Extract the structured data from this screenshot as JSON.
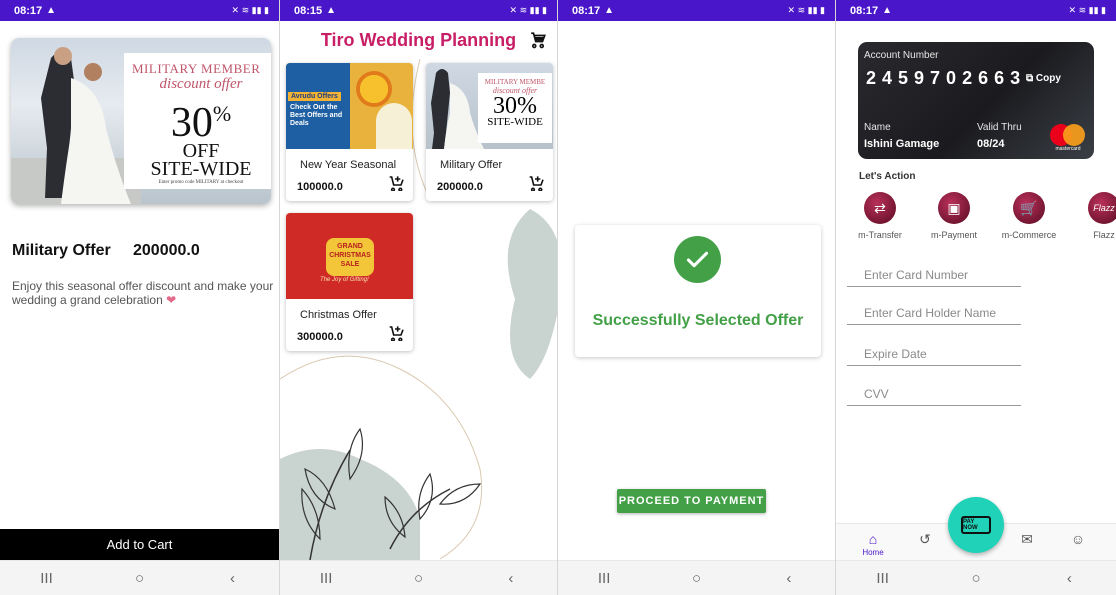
{
  "status_bars": [
    {
      "time": "08:17"
    },
    {
      "time": "08:15"
    },
    {
      "time": "08:17"
    },
    {
      "time": "08:17"
    }
  ],
  "status_icons": "✕ ≋ ▮▮ ▮",
  "nav_buttons": {
    "recents": "III",
    "home": "○",
    "back": "‹"
  },
  "screen1": {
    "promo": {
      "line1": "MILITARY MEMBER",
      "line2": "discount offer",
      "percent": "30",
      "percent_sign": "%",
      "off": "OFF",
      "site": "SITE-WIDE",
      "fine": "Enter promo code MILITARY at checkout"
    },
    "title": "Military Offer",
    "price": "200000.0",
    "description": "Enjoy this seasonal offer discount and make your wedding a grand celebration",
    "heart": "❤",
    "add_to_cart": "Add to Cart"
  },
  "screen2": {
    "app_title": "Tiro Wedding Planning",
    "cards": [
      {
        "name": "New Year Seasonal",
        "price": "100000.0",
        "img_tag": "Avrudu Offers",
        "img_text": "Check Out the Best Offers and Deals"
      },
      {
        "name": "Military Offer",
        "price": "200000.0",
        "img_l1": "MILITARY MEMBE",
        "img_l2": "discount offer",
        "img_l3": "30%",
        "img_l4": "SITE-WIDE"
      },
      {
        "name": "Christmas Offer",
        "price": "300000.0",
        "img_badge": "GRAND CHRISTMAS SALE",
        "img_sub": "The Joy of Gifting!"
      }
    ]
  },
  "screen3": {
    "message": "Successfully Selected Offer",
    "proceed_button": "PROCEED TO PAYMENT"
  },
  "screen4": {
    "card": {
      "account_label": "Account Number",
      "account_number": "2459702663",
      "copy_label": "Copy",
      "name_label": "Name",
      "name_value": "Ishini Gamage",
      "valid_label": "Valid Thru",
      "valid_value": "08/24",
      "brand_word": "mastercard"
    },
    "lets_action": "Let's Action",
    "actions": [
      {
        "label": "m-Transfer",
        "glyph": "⇄"
      },
      {
        "label": "m-Payment",
        "glyph": "▣"
      },
      {
        "label": "m-Commerce",
        "glyph": "🛒"
      },
      {
        "label": "Flazz",
        "glyph": "Flazz"
      }
    ],
    "fields": {
      "card_number_placeholder": "Enter Card Number",
      "holder_placeholder": "Enter Card Holder Name",
      "expire_placeholder": "Expire Date",
      "cvv_placeholder": "CVV"
    },
    "bottom_nav": {
      "home": "Home"
    },
    "fab_label": "PAY NOW"
  }
}
